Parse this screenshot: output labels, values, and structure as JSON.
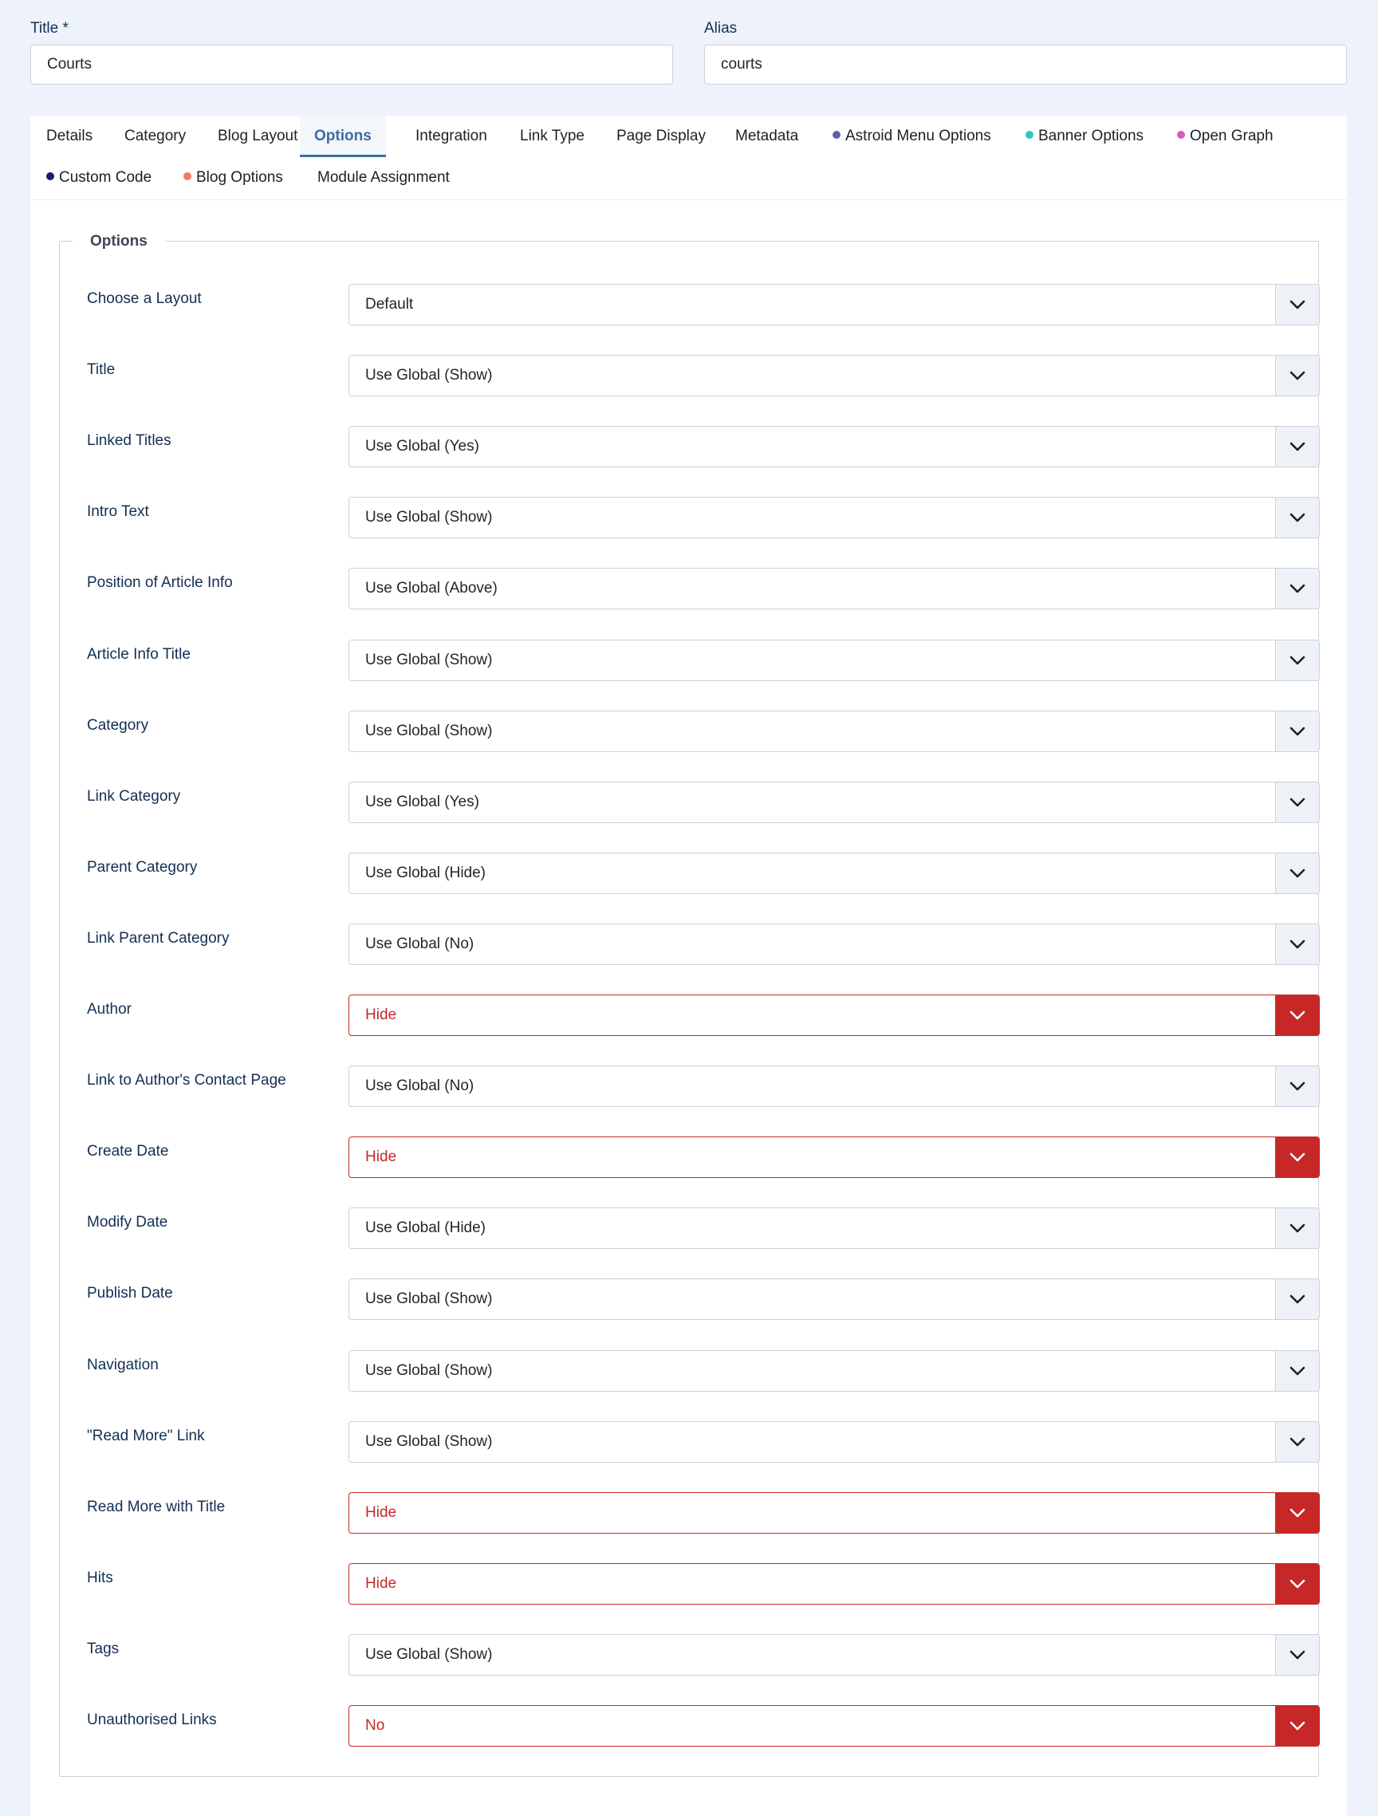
{
  "title_field": {
    "label": "Title *",
    "value": "Courts"
  },
  "alias_field": {
    "label": "Alias",
    "value": "courts"
  },
  "tabs": [
    {
      "label": "Details"
    },
    {
      "label": "Category"
    },
    {
      "label": "Blog Layout"
    },
    {
      "label": "Options",
      "active": true
    },
    {
      "label": "Integration"
    },
    {
      "label": "Link Type"
    },
    {
      "label": "Page Display"
    },
    {
      "label": "Metadata"
    },
    {
      "label": "Astroid Menu Options",
      "dot_color": "#5a5fb5"
    },
    {
      "label": "Banner Options",
      "dot_color": "#2ec5c0"
    },
    {
      "label": "Open Graph",
      "dot_color": "#d95bc6"
    },
    {
      "label": "Custom Code",
      "dot_color": "#151a7a"
    },
    {
      "label": "Blog Options",
      "dot_color": "#f07a5f"
    },
    {
      "label": "Module Assignment"
    }
  ],
  "options": {
    "legend": "Options",
    "rows": [
      {
        "label": "Choose a Layout",
        "value": "Default",
        "invalid": false
      },
      {
        "label": "Title",
        "value": "Use Global (Show)",
        "invalid": false
      },
      {
        "label": "Linked Titles",
        "value": "Use Global (Yes)",
        "invalid": false
      },
      {
        "label": "Intro Text",
        "value": "Use Global (Show)",
        "invalid": false
      },
      {
        "label": "Position of Article Info",
        "value": "Use Global (Above)",
        "invalid": false
      },
      {
        "label": "Article Info Title",
        "value": "Use Global (Show)",
        "invalid": false
      },
      {
        "label": "Category",
        "value": "Use Global (Show)",
        "invalid": false
      },
      {
        "label": "Link Category",
        "value": "Use Global (Yes)",
        "invalid": false
      },
      {
        "label": "Parent Category",
        "value": "Use Global (Hide)",
        "invalid": false
      },
      {
        "label": "Link Parent Category",
        "value": "Use Global (No)",
        "invalid": false
      },
      {
        "label": "Author",
        "value": "Hide",
        "invalid": true
      },
      {
        "label": "Link to Author's Contact Page",
        "value": "Use Global (No)",
        "invalid": false
      },
      {
        "label": "Create Date",
        "value": "Hide",
        "invalid": true
      },
      {
        "label": "Modify Date",
        "value": "Use Global (Hide)",
        "invalid": false
      },
      {
        "label": "Publish Date",
        "value": "Use Global (Show)",
        "invalid": false
      },
      {
        "label": "Navigation",
        "value": "Use Global (Show)",
        "invalid": false
      },
      {
        "label": "\"Read More\" Link",
        "value": "Use Global (Show)",
        "invalid": false
      },
      {
        "label": "Read More with Title",
        "value": "Hide",
        "invalid": true
      },
      {
        "label": "Hits",
        "value": "Hide",
        "invalid": true
      },
      {
        "label": "Tags",
        "value": "Use Global (Show)",
        "invalid": false
      },
      {
        "label": "Unauthorised Links",
        "value": "No",
        "invalid": true
      }
    ]
  },
  "colors": {
    "accent": "#3b6ea8",
    "error": "#c52827",
    "background": "#eef3fb"
  }
}
